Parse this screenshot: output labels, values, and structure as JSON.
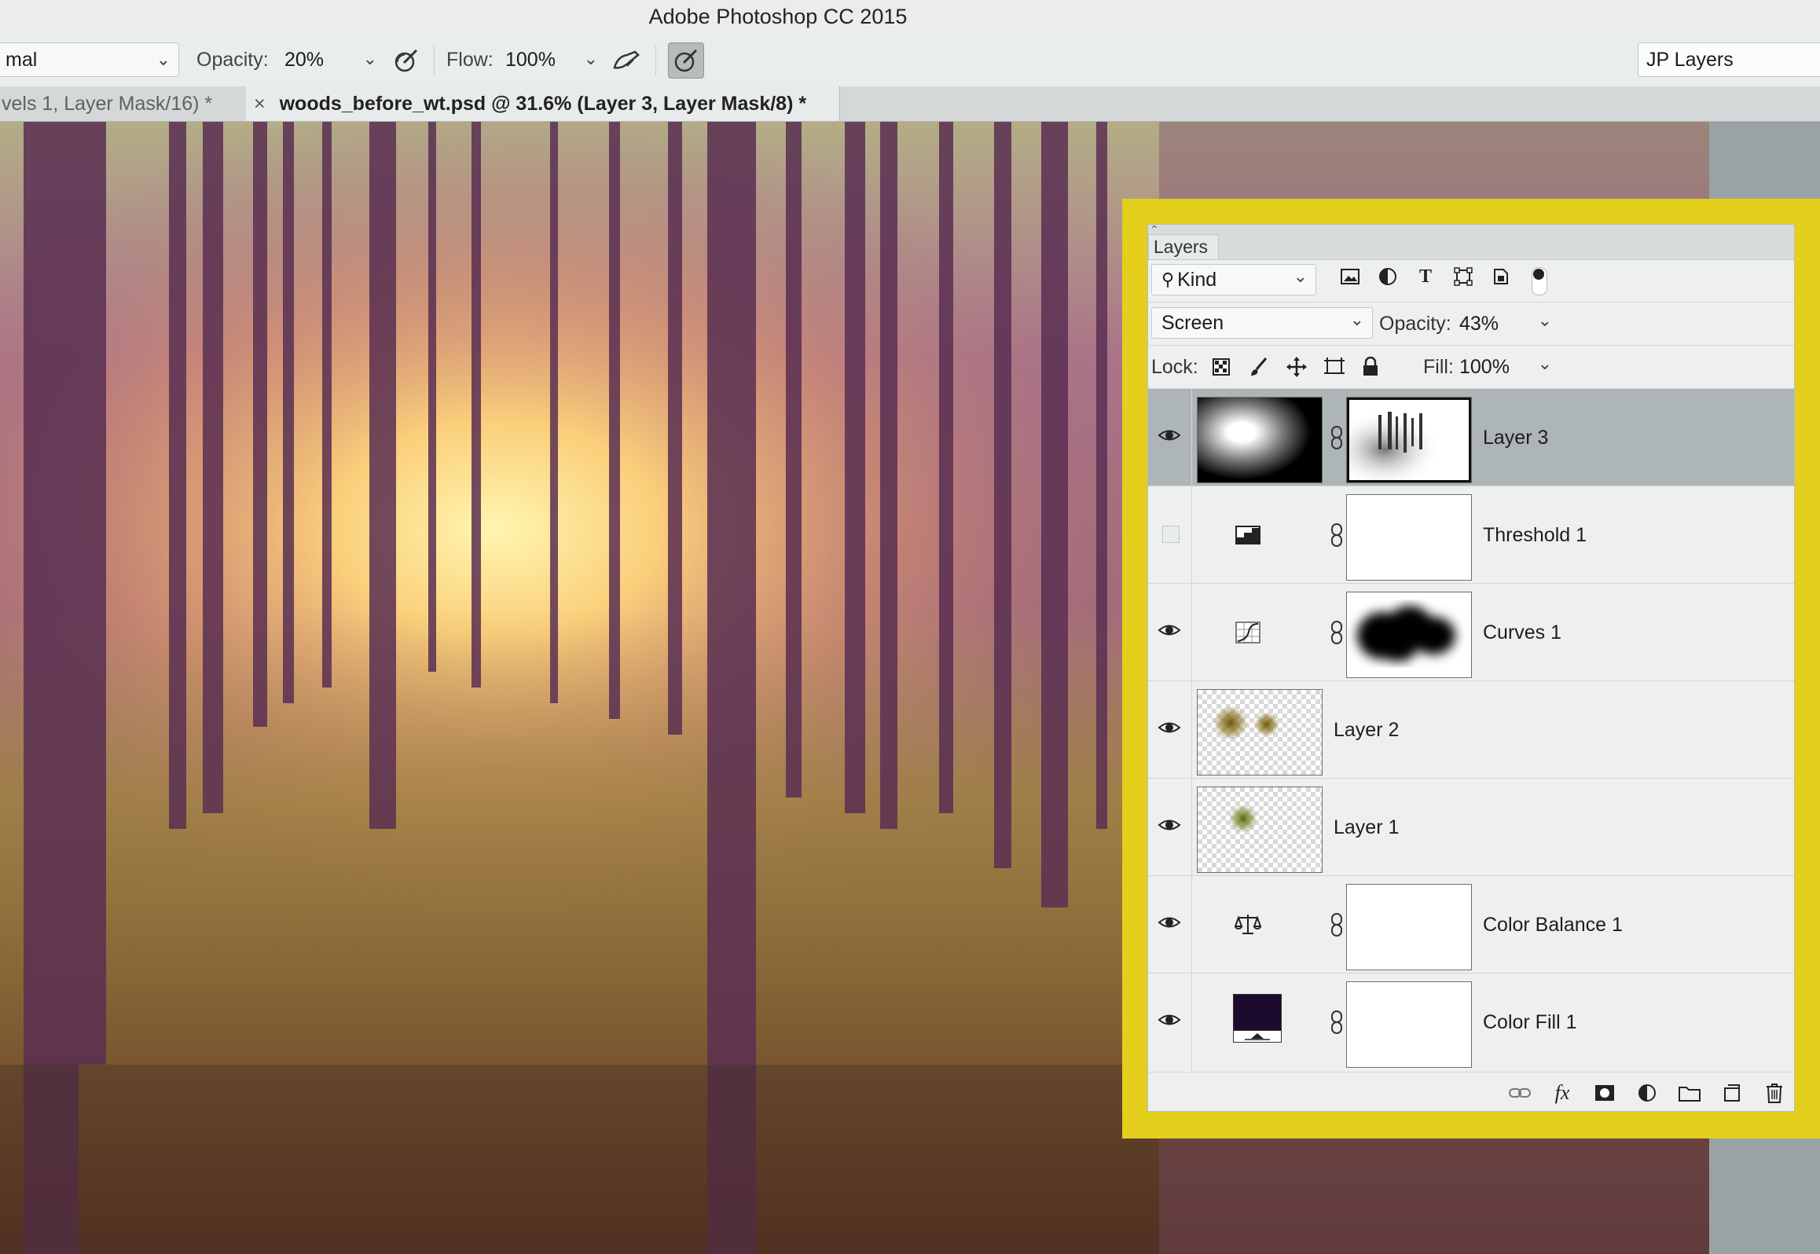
{
  "app": {
    "title": "Adobe Photoshop CC 2015"
  },
  "options_bar": {
    "mode_value": "mal",
    "opacity_label": "Opacity:",
    "opacity_value": "20%",
    "flow_label": "Flow:",
    "flow_value": "100%",
    "workspace_value": "JP Layers"
  },
  "tabs": [
    {
      "label": "vels 1, Layer Mask/16) *"
    },
    {
      "close": "×",
      "label": "woods_before_wt.psd @ 31.6% (Layer 3, Layer Mask/8) *"
    }
  ],
  "layers_panel": {
    "tab_label": "Layers",
    "filter_kind": "Kind",
    "blend_mode": "Screen",
    "opacity_label": "Opacity:",
    "opacity_value": "43%",
    "lock_label": "Lock:",
    "fill_label": "Fill:",
    "fill_value": "100%",
    "layers": [
      {
        "name": "Layer 3",
        "visible": true,
        "selected": true
      },
      {
        "name": "Threshold 1",
        "visible": false
      },
      {
        "name": "Curves 1",
        "visible": true
      },
      {
        "name": "Layer 2",
        "visible": true
      },
      {
        "name": "Layer 1",
        "visible": true
      },
      {
        "name": "Color Balance 1",
        "visible": true
      },
      {
        "name": "Color Fill 1",
        "visible": true,
        "fill_color": "#1c0b2e"
      }
    ]
  },
  "colors": {
    "highlight_frame": "#e3cf1c",
    "selected_layer": "#adb5b6",
    "panel_bg": "#eef0f0"
  }
}
